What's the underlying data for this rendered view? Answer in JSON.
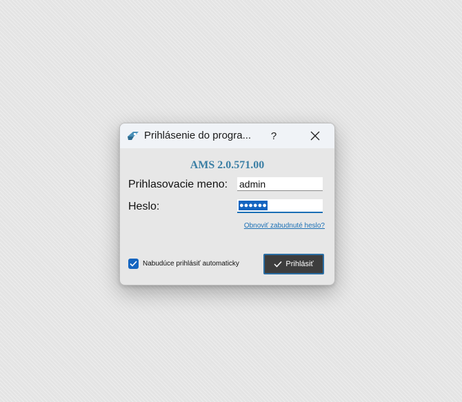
{
  "dialog": {
    "title": "Prihlásenie do progra...",
    "help_label": "?",
    "icons": {
      "app": "ams-app-icon",
      "close": "close-icon"
    }
  },
  "form": {
    "version": "AMS 2.0.571.00",
    "username_label": "Prihlasovacie meno:",
    "username_value": "admin",
    "password_label": "Heslo:",
    "password_mask": "●●●●●●",
    "forgot_link": "Obnoviť zabudnuté heslo?",
    "auto_login_label": "Nabudúce prihlásiť automaticky",
    "auto_login_checked": true,
    "login_button": "Prihlásiť"
  },
  "colors": {
    "accent": "#1565c0",
    "version_text": "#3a7ea4",
    "button_bg": "#3d3d3d"
  }
}
